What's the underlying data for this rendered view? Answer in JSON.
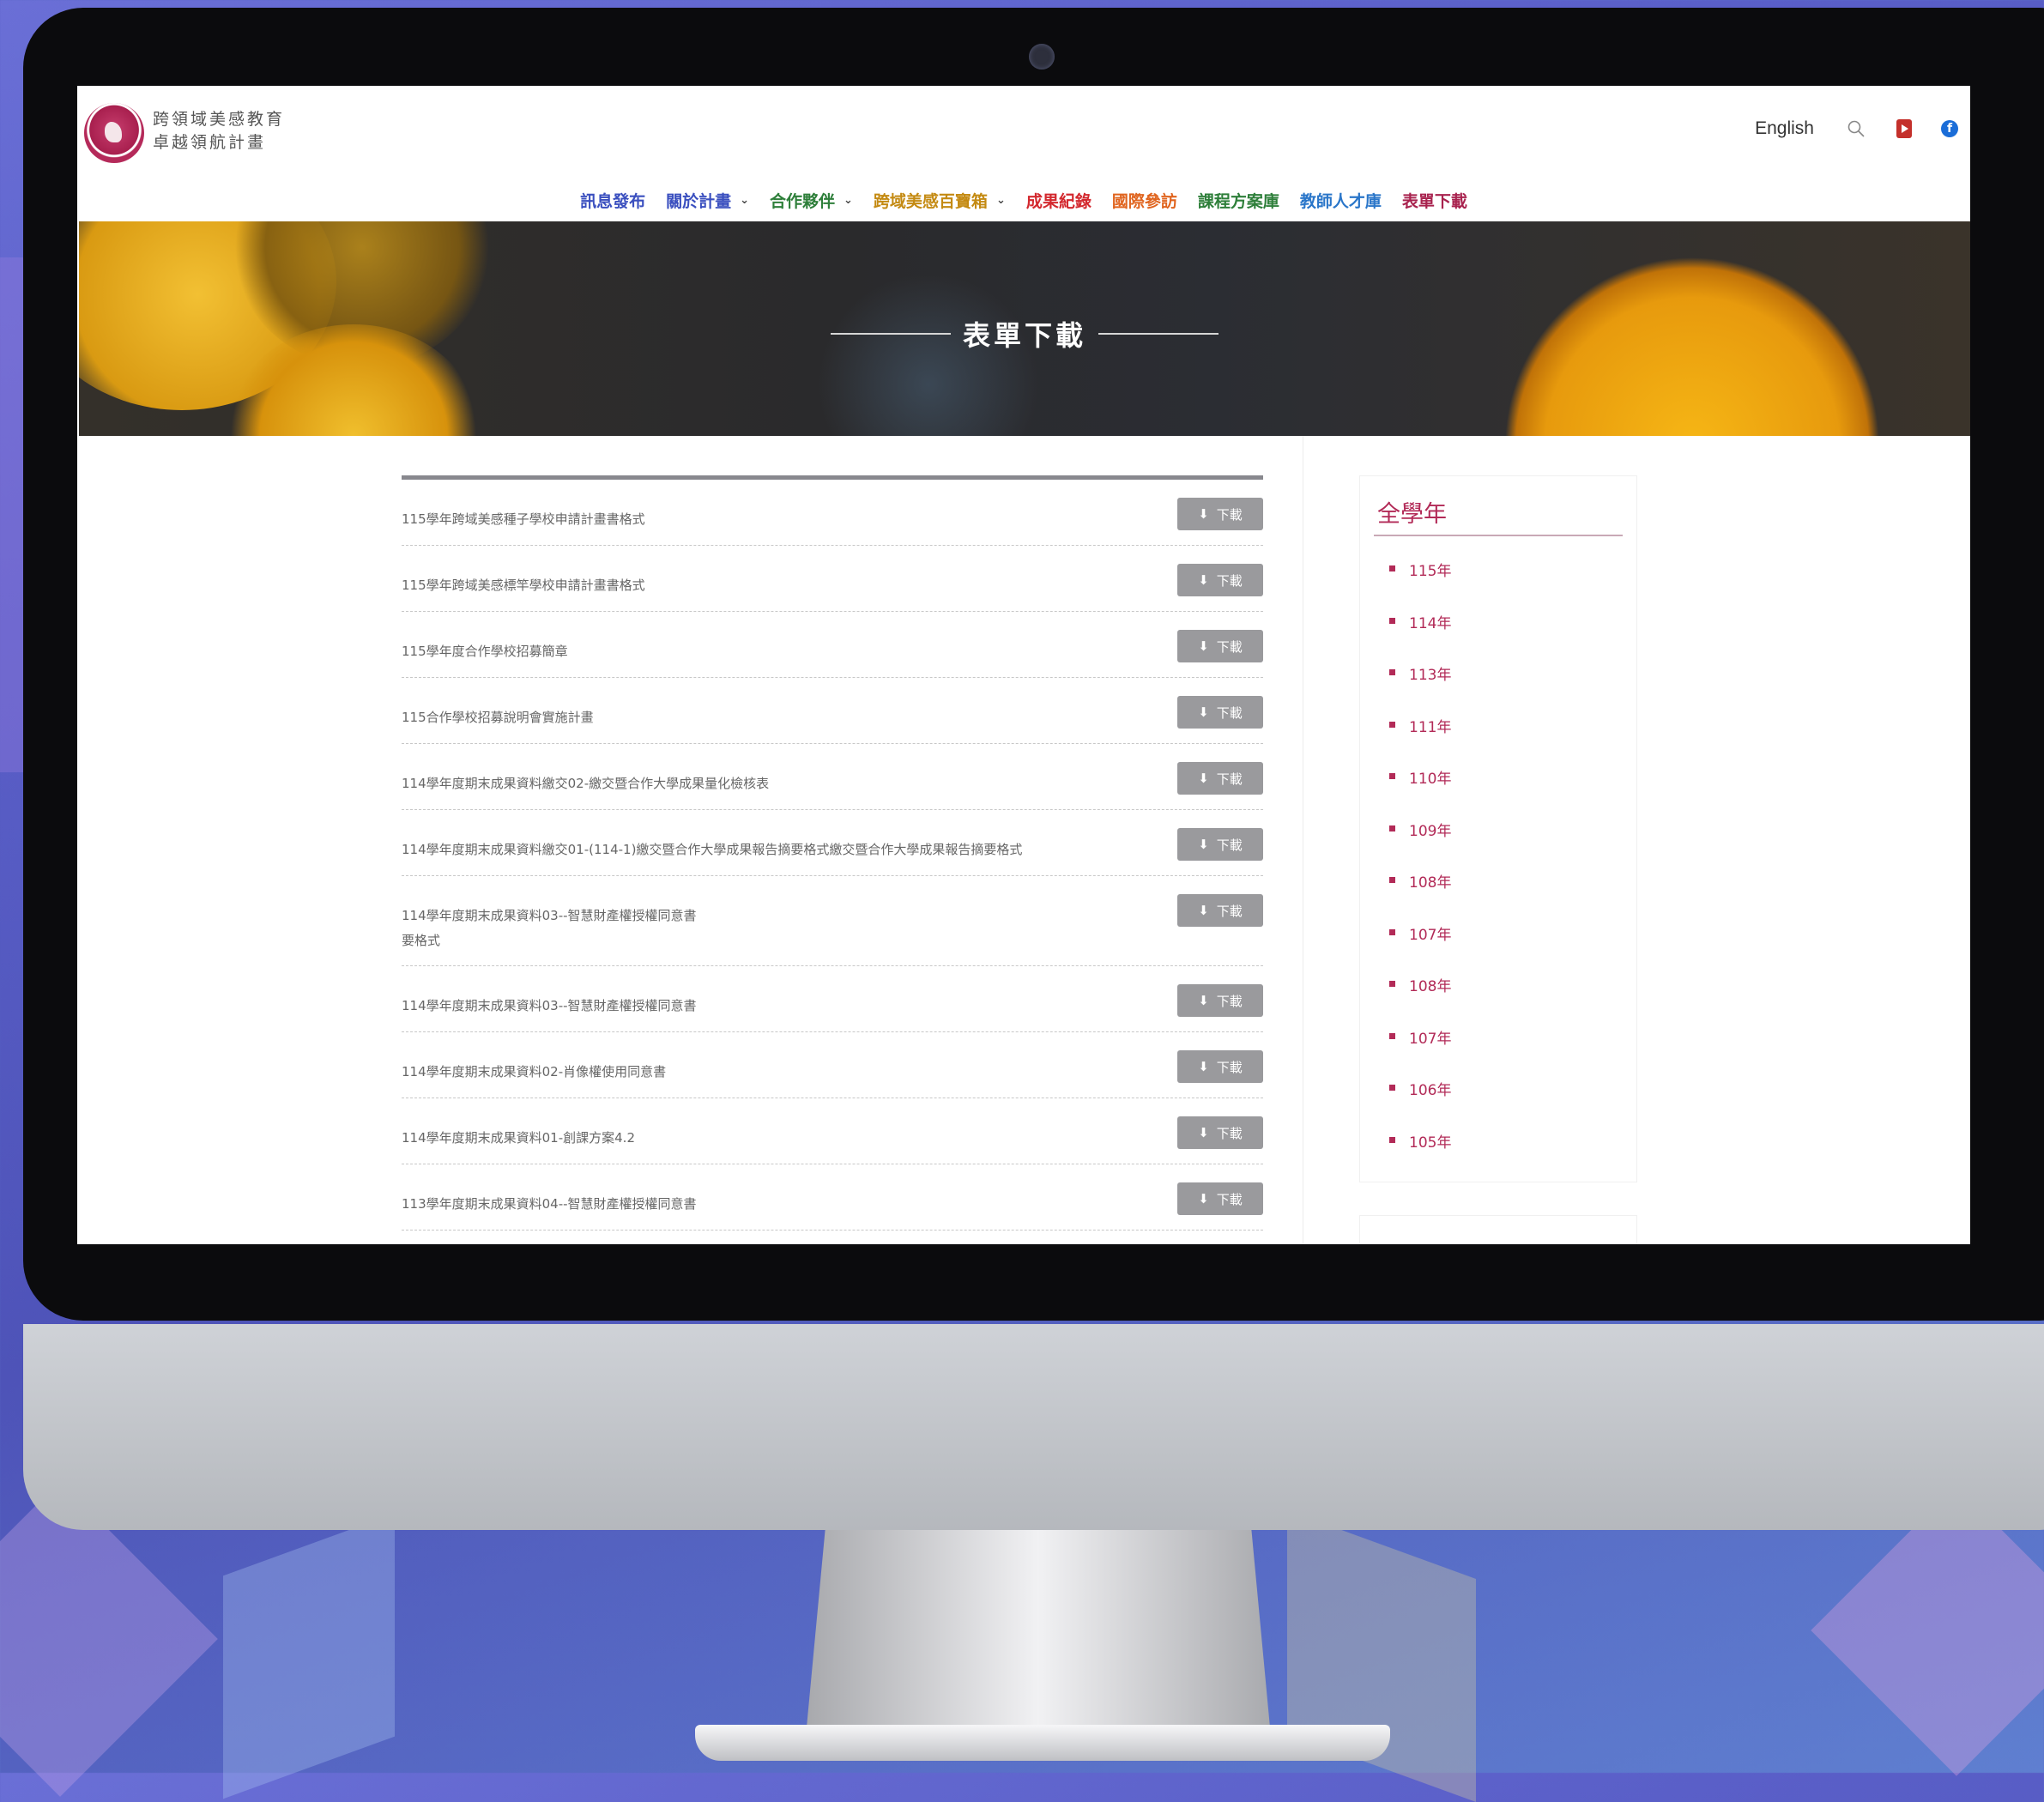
{
  "site": {
    "logo_line1": "跨領域美感教育",
    "logo_line2": "卓越領航計畫",
    "lang_label": "English"
  },
  "nav": [
    {
      "label": "訊息發布",
      "color": "#3a4fbf",
      "dropdown": false
    },
    {
      "label": "關於計畫",
      "color": "#3a4fbf",
      "dropdown": true
    },
    {
      "label": "合作夥伴",
      "color": "#2e7f3a",
      "dropdown": true
    },
    {
      "label": "跨域美感百寶箱",
      "color": "#c48a12",
      "dropdown": true
    },
    {
      "label": "成果紀錄",
      "color": "#d3282e",
      "dropdown": false
    },
    {
      "label": "國際參訪",
      "color": "#e0641e",
      "dropdown": false
    },
    {
      "label": "課程方案庫",
      "color": "#2e7f3a",
      "dropdown": false
    },
    {
      "label": "教師人才庫",
      "color": "#2a76c9",
      "dropdown": false
    },
    {
      "label": "表單下載",
      "color": "#a8224e",
      "dropdown": false,
      "active": true
    }
  ],
  "banner": {
    "title": "表單下載"
  },
  "downloads": {
    "button_label": "下載",
    "items": [
      "115學年跨域美感種子學校申請計畫書格式",
      "115學年跨域美感標竿學校申請計畫書格式",
      "115學年度合作學校招募簡章",
      "115合作學校招募說明會實施計畫",
      "114學年度期末成果資料繳交02-繳交暨合作大學成果量化檢核表",
      "114學年度期末成果資料繳交01-(114-1)繳交暨合作大學成果報告摘要格式繳交暨合作大學成果報告摘要格式",
      "114學年度期末成果資料03--智慧財產權授權同意書\n要格式",
      "114學年度期末成果資料03--智慧財產權授權同意書",
      "114學年度期末成果資料02-肖像權使用同意書",
      "114學年度期末成果資料01-創課方案4.2",
      "113學年度期末成果資料04--智慧財產權授權同意書"
    ]
  },
  "sidebar": {
    "title": "全學年",
    "years": [
      "115年",
      "114年",
      "113年",
      "111年",
      "110年",
      "109年",
      "108年",
      "107年",
      "108年",
      "107年",
      "106年",
      "105年"
    ],
    "year_color": "#b22a57"
  },
  "icons": {
    "search": "search-icon",
    "youtube": "youtube-icon",
    "facebook": "facebook-icon",
    "download": "download-arrow-icon"
  }
}
